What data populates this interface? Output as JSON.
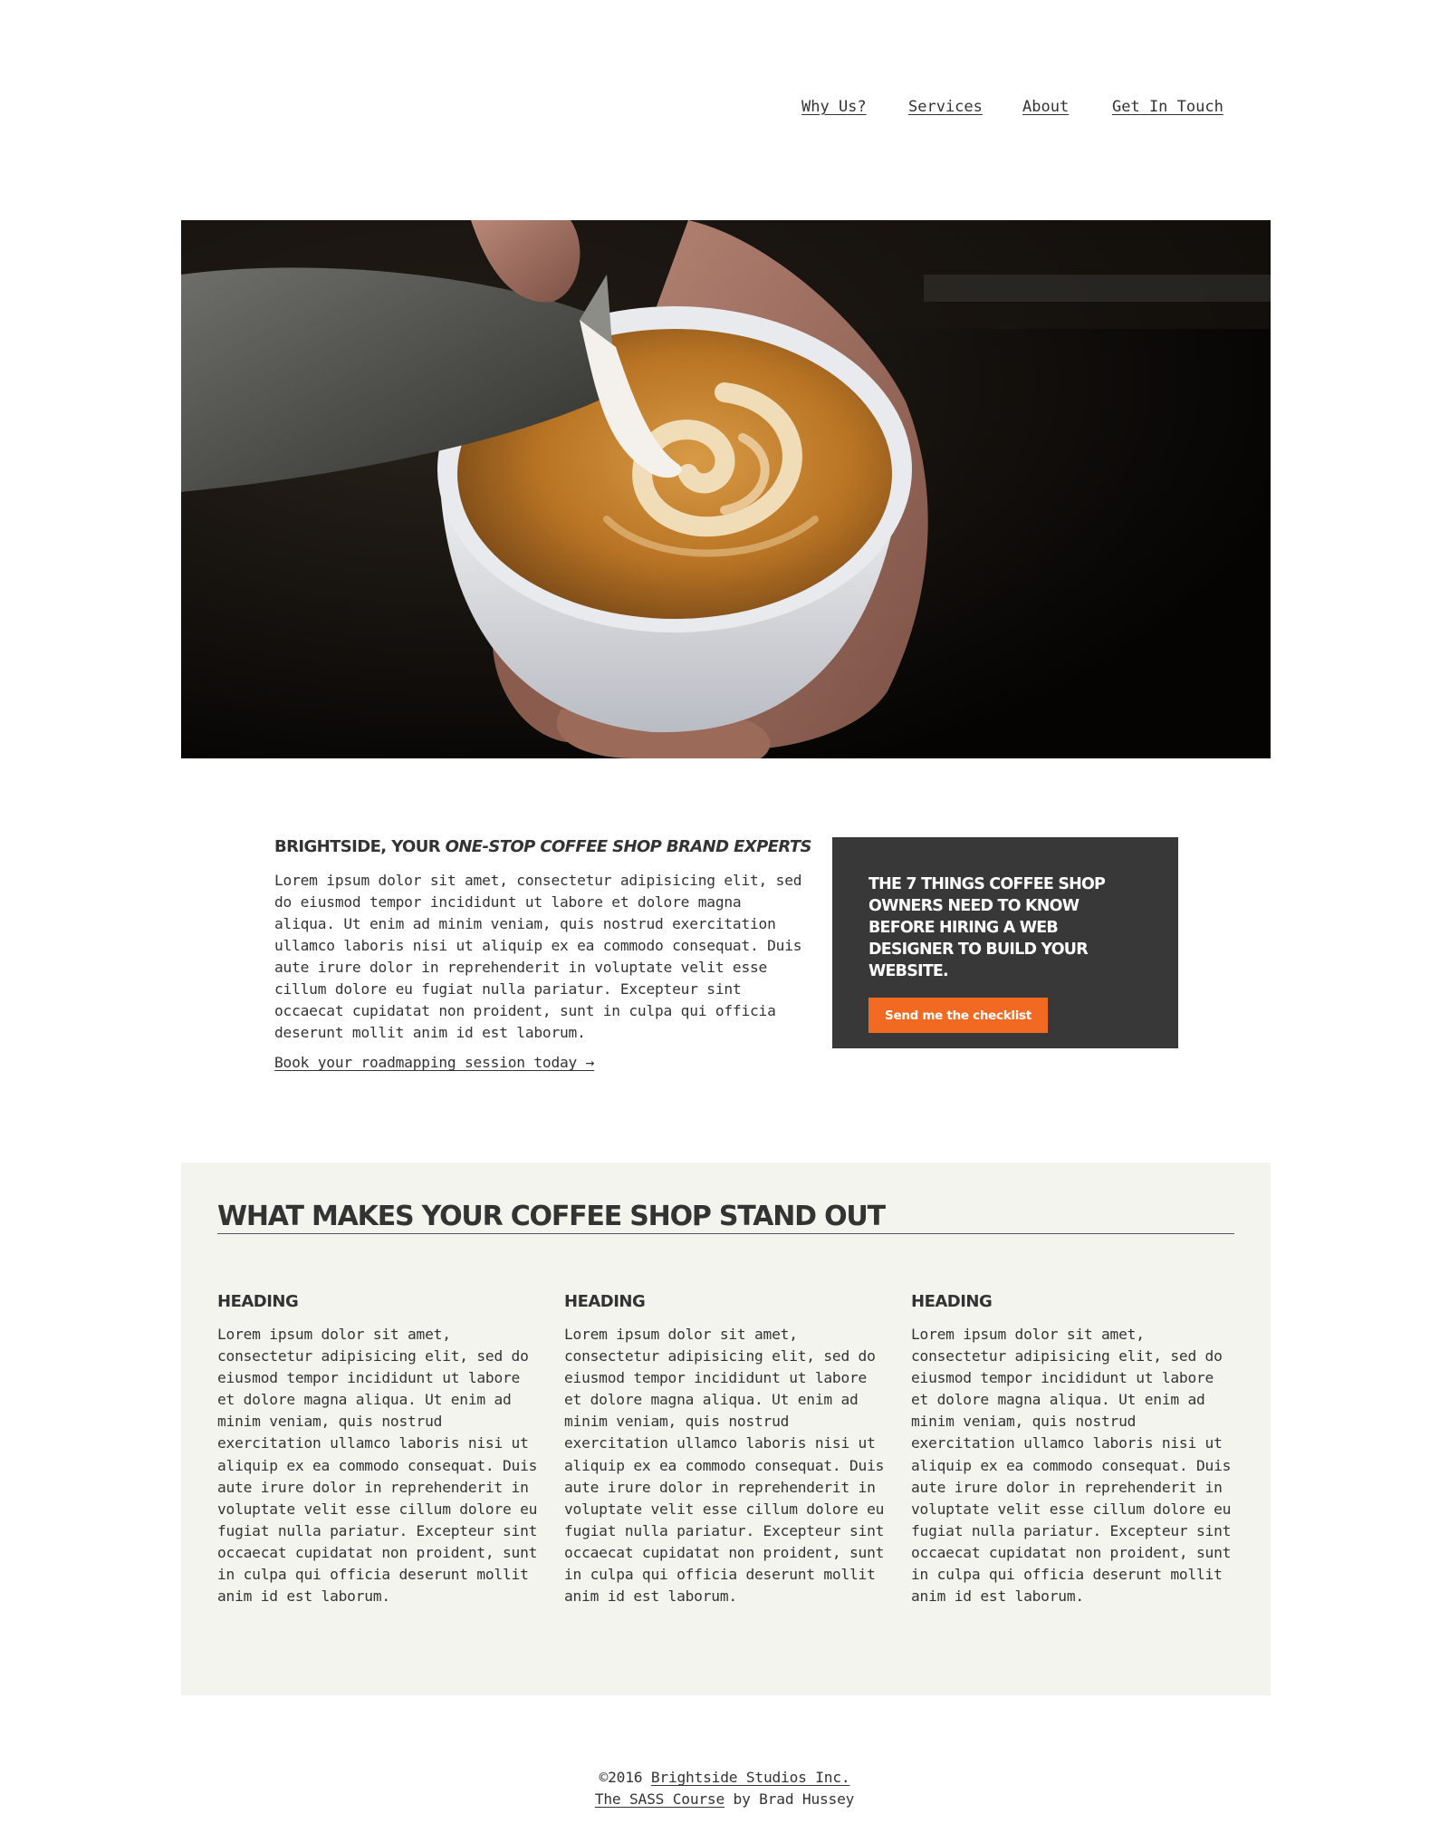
{
  "nav": {
    "items": [
      {
        "label": "Why Us?"
      },
      {
        "label": "Services"
      },
      {
        "label": "About"
      },
      {
        "label": "Get In Touch"
      }
    ]
  },
  "intro": {
    "heading_plain": "BRIGHTSIDE, YOUR ",
    "heading_emphasis": "ONE-STOP COFFEE SHOP BRAND EXPERTS",
    "body": "Lorem ipsum dolor sit amet, consectetur adipisicing elit, sed do eiusmod tempor incididunt ut labore et dolore magna aliqua. Ut enim ad minim veniam, quis nostrud exercitation ullamco laboris nisi ut aliquip ex ea commodo consequat. Duis aute irure dolor in reprehenderit in voluptate velit esse cillum dolore eu fugiat nulla pariatur. Excepteur sint occaecat cupidatat non proident, sunt in culpa qui officia deserunt mollit anim id est laborum.",
    "link": "Book your roadmapping session today →"
  },
  "cta": {
    "title": "THE 7 THINGS COFFEE SHOP OWNERS NEED TO KNOW BEFORE HIRING A WEB DESIGNER TO BUILD YOUR WEBSITE.",
    "button": "Send me the checklist",
    "button_color": "#f26a22",
    "background": "#383838"
  },
  "features": {
    "title": "WHAT MAKES YOUR COFFEE SHOP STAND OUT",
    "columns": [
      {
        "heading": "HEADING",
        "body": "Lorem ipsum dolor sit amet, consectetur adipisicing elit, sed do eiusmod tempor incididunt ut labore et dolore magna aliqua. Ut enim ad minim veniam, quis nostrud exercitation ullamco laboris nisi ut aliquip ex ea commodo consequat. Duis aute irure dolor in reprehenderit in voluptate velit esse cillum dolore eu fugiat nulla pariatur. Excepteur sint occaecat cupidatat non proident, sunt in culpa qui officia deserunt mollit anim id est laborum."
      },
      {
        "heading": "HEADING",
        "body": "Lorem ipsum dolor sit amet, consectetur adipisicing elit, sed do eiusmod tempor incididunt ut labore et dolore magna aliqua. Ut enim ad minim veniam, quis nostrud exercitation ullamco laboris nisi ut aliquip ex ea commodo consequat. Duis aute irure dolor in reprehenderit in voluptate velit esse cillum dolore eu fugiat nulla pariatur. Excepteur sint occaecat cupidatat non proident, sunt in culpa qui officia deserunt mollit anim id est laborum."
      },
      {
        "heading": "HEADING",
        "body": "Lorem ipsum dolor sit amet, consectetur adipisicing elit, sed do eiusmod tempor incididunt ut labore et dolore magna aliqua. Ut enim ad minim veniam, quis nostrud exercitation ullamco laboris nisi ut aliquip ex ea commodo consequat. Duis aute irure dolor in reprehenderit in voluptate velit esse cillum dolore eu fugiat nulla pariatur. Excepteur sint occaecat cupidatat non proident, sunt in culpa qui officia deserunt mollit anim id est laborum."
      }
    ]
  },
  "footer": {
    "copyright": "©2016 ",
    "company_link": "Brightside Studios Inc.",
    "course_link": "The SASS Course",
    "byline": " by Brad Hussey"
  }
}
